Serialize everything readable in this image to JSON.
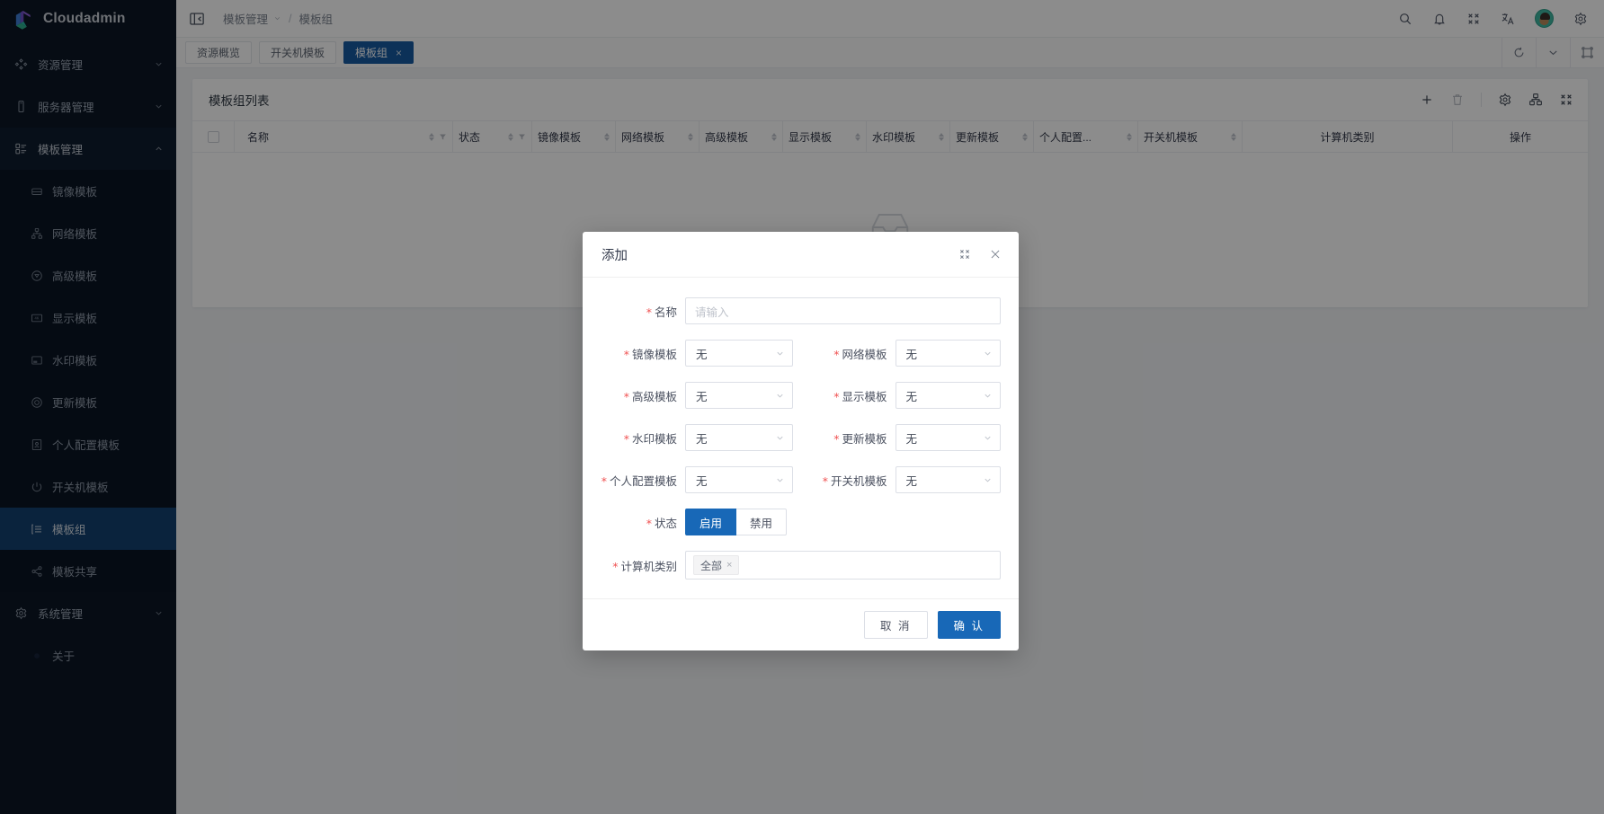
{
  "brand": {
    "name": "Cloudadmin",
    "logo_icon": "cloudadmin-logo"
  },
  "sidebar": {
    "groups": [
      {
        "label": "资源管理",
        "icon": "resource-icon",
        "expanded": false
      },
      {
        "label": "服务器管理",
        "icon": "server-icon",
        "expanded": false
      }
    ],
    "template_group": {
      "label": "模板管理",
      "icon": "template-icon",
      "items": [
        {
          "label": "镜像模板",
          "icon": "image-template-icon",
          "active": false
        },
        {
          "label": "网络模板",
          "icon": "network-template-icon",
          "active": false
        },
        {
          "label": "高级模板",
          "icon": "advanced-template-icon",
          "active": false
        },
        {
          "label": "显示模板",
          "icon": "display-template-icon",
          "active": false
        },
        {
          "label": "水印模板",
          "icon": "watermark-template-icon",
          "active": false
        },
        {
          "label": "更新模板",
          "icon": "update-template-icon",
          "active": false
        },
        {
          "label": "个人配置模板",
          "icon": "personal-config-template-icon",
          "active": false
        },
        {
          "label": "开关机模板",
          "icon": "power-template-icon",
          "active": false
        },
        {
          "label": "模板组",
          "icon": "template-group-icon",
          "active": true
        },
        {
          "label": "模板共享",
          "icon": "share-icon",
          "active": false
        }
      ]
    },
    "system_group": {
      "label": "系统管理",
      "icon": "gear-icon"
    },
    "about": {
      "label": "关于",
      "icon": "about-icon"
    }
  },
  "topbar": {
    "collapse_icon": "collapse-sidebar-icon",
    "breadcrumb": {
      "parent": "模板管理",
      "current": "模板组",
      "separator": "/"
    },
    "icons": [
      "search-icon",
      "bell-icon",
      "fullscreen-exit-icon",
      "translate-icon",
      "gear-icon"
    ],
    "avatar": "user-avatar"
  },
  "tabstrip": {
    "tabs": [
      {
        "label": "资源概览",
        "active": false,
        "closable": false
      },
      {
        "label": "开关机模板",
        "active": false,
        "closable": false
      },
      {
        "label": "模板组",
        "active": true,
        "closable": true,
        "close_glyph": "×"
      }
    ],
    "tools": [
      "refresh-icon",
      "chevron-down-icon",
      "fullscreen-icon"
    ]
  },
  "panel": {
    "title": "模板组列表",
    "tools": [
      "add-icon",
      "delete-icon",
      "gear-icon",
      "column-settings-icon",
      "fullscreen-exit-icon"
    ],
    "add_glyph": "+"
  },
  "table": {
    "columns": [
      {
        "label": "",
        "kind": "checkbox"
      },
      {
        "label": "名称",
        "sortable": true,
        "filterable": true
      },
      {
        "label": "状态",
        "sortable": true,
        "filterable": true
      },
      {
        "label": "镜像模板",
        "sortable": true,
        "filterable": false
      },
      {
        "label": "网络模板",
        "sortable": true,
        "filterable": false
      },
      {
        "label": "高级模板",
        "sortable": true,
        "filterable": false
      },
      {
        "label": "显示模板",
        "sortable": true,
        "filterable": false
      },
      {
        "label": "水印模板",
        "sortable": true,
        "filterable": false
      },
      {
        "label": "更新模板",
        "sortable": true,
        "filterable": false
      },
      {
        "label": "个人配置...",
        "sortable": true,
        "filterable": false
      },
      {
        "label": "开关机模板",
        "sortable": true,
        "filterable": false
      },
      {
        "label": "计算机类别",
        "sortable": false,
        "filterable": false
      },
      {
        "label": "操作",
        "sortable": false,
        "filterable": false
      }
    ],
    "rows": [],
    "empty_text": "",
    "empty_icon": "empty-inbox-icon"
  },
  "modal": {
    "title": "添加",
    "maximize_icon": "maximize-icon",
    "close_icon": "close-icon",
    "fields": {
      "name": {
        "label": "名称",
        "required": true,
        "value": "",
        "placeholder": "请输入"
      },
      "image_template": {
        "label": "镜像模板",
        "required": true,
        "value": "无"
      },
      "network_template": {
        "label": "网络模板",
        "required": true,
        "value": "无"
      },
      "advanced_template": {
        "label": "高级模板",
        "required": true,
        "value": "无"
      },
      "display_template": {
        "label": "显示模板",
        "required": true,
        "value": "无"
      },
      "watermark_template": {
        "label": "水印模板",
        "required": true,
        "value": "无"
      },
      "update_template": {
        "label": "更新模板",
        "required": true,
        "value": "无"
      },
      "personal_config_template": {
        "label": "个人配置模板",
        "required": true,
        "value": "无"
      },
      "power_template": {
        "label": "开关机模板",
        "required": true,
        "value": "无"
      },
      "status": {
        "label": "状态",
        "required": true,
        "options": [
          {
            "label": "启用",
            "selected": true
          },
          {
            "label": "禁用",
            "selected": false
          }
        ]
      },
      "computer_category": {
        "label": "计算机类别",
        "required": true,
        "tags": [
          {
            "label": "全部",
            "remove_glyph": "×"
          }
        ]
      }
    },
    "required_marker": "*",
    "buttons": {
      "cancel": "取 消",
      "confirm": "确 认"
    }
  },
  "colors": {
    "sidebar_bg": "#0b1625",
    "sidebar_active": "#13406f",
    "primary": "#1868b7",
    "tab_active": "#1659a0",
    "required_red": "#f05252"
  }
}
